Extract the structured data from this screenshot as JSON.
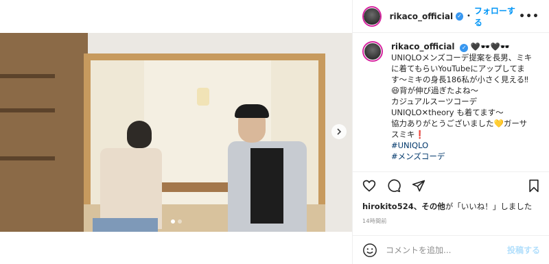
{
  "post": {
    "username": "rikaco_official",
    "follow_label": "フォローする",
    "separator": "•",
    "more_label": "•••",
    "caption": {
      "username": "rikaco_official",
      "emoji_after_name": "🖤🕶️🖤🕶️",
      "lines": [
        "UNIQLOメンズコーデ提案を長男、ミキ",
        "に着てもらいYouTubeにアップしてま",
        "す〜ミキの身長186私が小さく見える‼",
        "😆背が伸び過ぎたよね〜",
        "カジュアルスーツコーデ",
        "UNIQLO✕theory も着てます〜",
        "協力ありがとうございました💛ガーサ",
        "スミキ❗"
      ],
      "hashtags": [
        "#UNIQLO",
        "#メンズコーデ"
      ]
    },
    "likes_text_user": "hirokito524",
    "likes_text_rest": "、その他",
    "likes_text_suffix": "が「いいね！」しました",
    "timestamp": "14時間前",
    "comment_placeholder": "コメントを追加...",
    "post_label": "投稿する",
    "colors": {
      "accent": "#0095f6",
      "verified": "#3897f0",
      "hashtag": "#00376b"
    }
  },
  "photo": {
    "slide_count": 2,
    "active_slide": 1
  }
}
